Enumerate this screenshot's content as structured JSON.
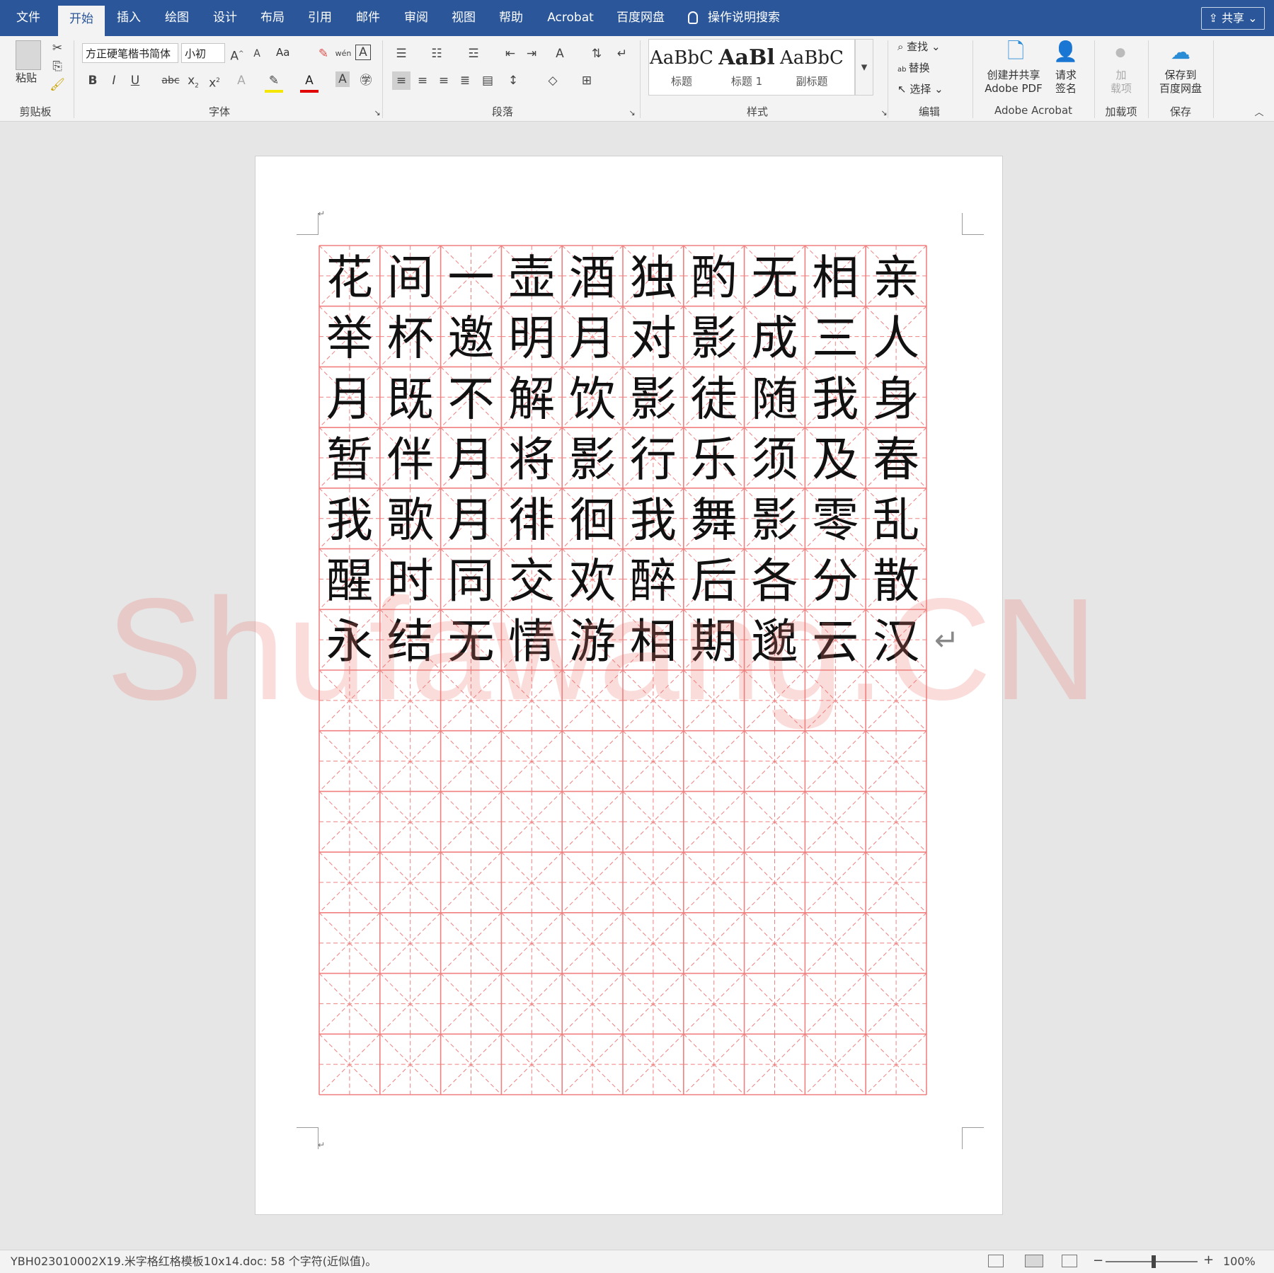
{
  "menu": {
    "tabs": [
      "文件",
      "开始",
      "插入",
      "绘图",
      "设计",
      "布局",
      "引用",
      "邮件",
      "审阅",
      "视图",
      "帮助",
      "Acrobat",
      "百度网盘"
    ],
    "active_tab": "开始",
    "tell_me": "操作说明搜索",
    "share": "共享"
  },
  "ribbon": {
    "clipboard": {
      "paste": "粘贴",
      "group": "剪贴板"
    },
    "font": {
      "name": "方正硬笔楷书简体",
      "size": "小初",
      "case_btn": "Aa",
      "group": "字体"
    },
    "paragraph": {
      "group": "段落"
    },
    "styles": {
      "items": [
        {
          "preview": "AaBbC",
          "name": "标题"
        },
        {
          "preview": "AaBl",
          "name": "标题 1"
        },
        {
          "preview": "AaBbC",
          "name": "副标题"
        }
      ],
      "group": "样式"
    },
    "editing": {
      "find": "查找",
      "replace": "替换",
      "select": "选择",
      "group": "编辑"
    },
    "acrobat": {
      "create_line1": "创建并共享",
      "create_line2": "Adobe PDF",
      "sign_line1": "请求",
      "sign_line2": "签名",
      "group": "Adobe Acrobat"
    },
    "addins": {
      "line1": "加",
      "line2": "载项",
      "group": "加载项"
    },
    "baidu": {
      "line1": "保存到",
      "line2": "百度网盘",
      "group": "保存"
    }
  },
  "document": {
    "grid_rows_total": 14,
    "grid_cols": 10,
    "characters": [
      [
        "花",
        "间",
        "一",
        "壶",
        "酒",
        "独",
        "酌",
        "无",
        "相",
        "亲"
      ],
      [
        "举",
        "杯",
        "邀",
        "明",
        "月",
        "对",
        "影",
        "成",
        "三",
        "人"
      ],
      [
        "月",
        "既",
        "不",
        "解",
        "饮",
        "影",
        "徒",
        "随",
        "我",
        "身"
      ],
      [
        "暂",
        "伴",
        "月",
        "将",
        "影",
        "行",
        "乐",
        "须",
        "及",
        "春"
      ],
      [
        "我",
        "歌",
        "月",
        "徘",
        "徊",
        "我",
        "舞",
        "影",
        "零",
        "乱"
      ],
      [
        "醒",
        "时",
        "同",
        "交",
        "欢",
        "醉",
        "后",
        "各",
        "分",
        "散"
      ],
      [
        "永",
        "结",
        "无",
        "情",
        "游",
        "相",
        "期",
        "邈",
        "云",
        "汉"
      ]
    ],
    "grid_color": "#f08080",
    "watermark": "Shufawang.CN",
    "paragraph_mark": "↵"
  },
  "status": {
    "text": "YBH023010002X19.米字格红格模板10x14.doc: 58 个字符(近似值)。",
    "zoom": "100%",
    "zoom_percent": 100
  }
}
